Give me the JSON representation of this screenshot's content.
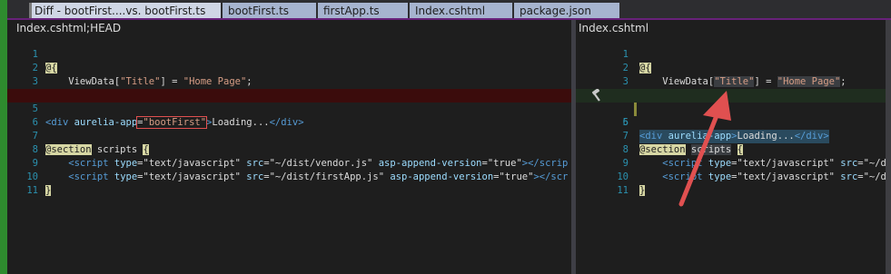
{
  "tabs": [
    {
      "label": "Diff - bootFirst....vs. bootFirst.ts"
    },
    {
      "label": "bootFirst.ts"
    },
    {
      "label": "firstApp.ts"
    },
    {
      "label": "Index.cshtml"
    },
    {
      "label": "package.json"
    }
  ],
  "left_pane": {
    "title": "Index.cshtml;HEAD",
    "lines": [
      {
        "num": "1",
        "text": "@{"
      },
      {
        "num": "2",
        "text": "    ViewData[\"Title\"] = \"Home Page\";"
      },
      {
        "num": "3",
        "text": "}"
      },
      {
        "num": "4",
        "text": ""
      },
      {
        "num": "5",
        "text": "<div aurelia-app=\"bootFirst\">Loading...</div>"
      },
      {
        "num": "6",
        "text": ""
      },
      {
        "num": "7",
        "text": "@section scripts {"
      },
      {
        "num": "8",
        "text": "    <script type=\"text/javascript\" src=\"~/dist/vendor.js\" asp-append-version=\"true\"></scrip"
      },
      {
        "num": "9",
        "text": "    <script type=\"text/javascript\" src=\"~/dist/firstApp.js\" asp-append-version=\"true\"></scr"
      },
      {
        "num": "10",
        "text": "}"
      },
      {
        "num": "11",
        "text": ""
      }
    ]
  },
  "right_pane": {
    "title": "Index.cshtml",
    "lines": [
      {
        "num": "1",
        "text": "@{"
      },
      {
        "num": "2",
        "text": "    ViewData[\"Title\"] = \"Home Page\";"
      },
      {
        "num": "3",
        "text": "}"
      },
      {
        "num": "4",
        "text": ""
      },
      {
        "num": "5",
        "text": "<div aurelia-app>Loading...</div>"
      },
      {
        "num": "6",
        "text": ""
      },
      {
        "num": "7",
        "text": "@section scripts {"
      },
      {
        "num": "8",
        "text": "    <script type=\"text/javascript\" src=\"~/di"
      },
      {
        "num": "9",
        "text": "    <script type=\"text/javascript\" src=\"~/di"
      },
      {
        "num": "10",
        "text": "}"
      },
      {
        "num": "11",
        "text": ""
      }
    ]
  },
  "colors": {
    "accent": "#68217a",
    "line_numbers": "#2b91af",
    "deleted_bg": "#3b0c0c",
    "annotation": "#e05050"
  },
  "icons": {
    "gutter": "hammer-icon",
    "annotation": "red-arrow"
  }
}
